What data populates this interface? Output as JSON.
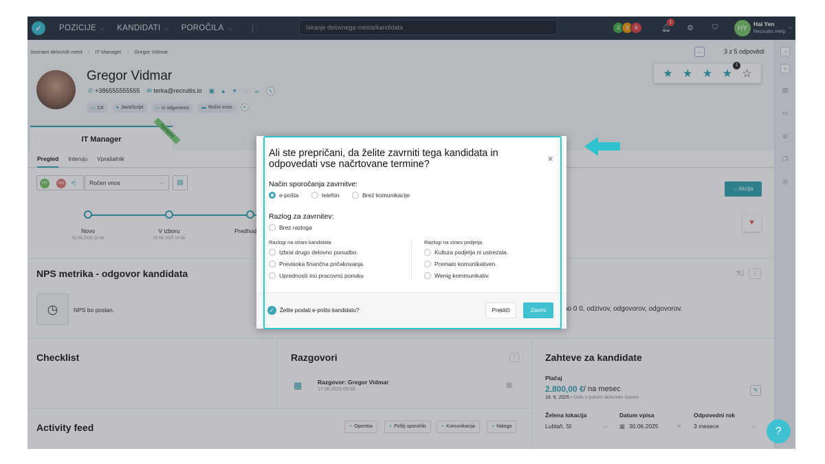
{
  "nav": {
    "items": [
      "POZICIJE",
      "KANDIDATI",
      "POROČILA"
    ],
    "search_placeholder": "Iskanje delovnega mesta/kandidata",
    "status_badges": [
      {
        "value": "0",
        "color": "#4caf50"
      },
      {
        "value": "0",
        "color": "#f39c12"
      },
      {
        "value": "6",
        "color": "#e04848"
      }
    ],
    "notification_count": "1",
    "user": {
      "initials": "HY",
      "name": "Hai Yen",
      "org": "Recruitis Help"
    }
  },
  "breadcrumb": [
    "Seznam delovnih mest",
    "IT Manager",
    "Gregor Vidmar"
  ],
  "pager": "3 z 5 odpovědí",
  "candidate": {
    "name": "Gregor Vidmar",
    "phone": "+386555555555",
    "email": "terka@recruitis.io",
    "tags": [
      "C#",
      "JavaScript",
      "Iz odgovorov",
      "Ročni vnos"
    ],
    "rating": 4,
    "rating_count": "1"
  },
  "job": {
    "title": "IT Manager",
    "ribbon": "Sprejeto"
  },
  "tabs": [
    "Pregled",
    "Intervju",
    "Vprašalnik"
  ],
  "pipeline": {
    "avatars": [
      {
        "initials": "HY",
        "color": "#7cc66f"
      },
      {
        "initials": "AN",
        "color": "#e07a7a"
      }
    ],
    "source": "Ročen vnos",
    "action": "Akcija",
    "steps": [
      {
        "label": "Novo",
        "date": "05.06.2025 10:48"
      },
      {
        "label": "V izboru",
        "date": "05.06.2025 10:56"
      },
      {
        "label": "Predhodni p",
        "date": ""
      }
    ]
  },
  "nps": {
    "title": "NPS metrika - odgovor kandidata",
    "status": "NPS bo poslan.",
    "right_text": "no 0 0, odzivov, odgovorov, odgovorov."
  },
  "checklist": {
    "title": "Checklist"
  },
  "razgovori": {
    "title": "Razgovori",
    "item_name": "Razgovor: Gregor Vidmar",
    "item_date": "17.06.2025 09:00"
  },
  "zahteve": {
    "title": "Zahteve za kandidate",
    "salary_label": "Plačaj",
    "salary_amount": "2.800,00 €",
    "salary_period": "/ na mesec",
    "salary_date": "16. 6. 2025",
    "salary_note": "Delo s polnim delovnim časom",
    "location_label": "Želena lokacija",
    "location_value": "Lublaň, SI",
    "start_label": "Datum vpisa",
    "start_value": "30.06.2025",
    "notice_label": "Odpovedni rok",
    "notice_value": "3 mesece"
  },
  "activity": {
    "title": "Activity feed",
    "buttons": [
      "Opomba",
      "Pošlji sporočilo",
      "Komunikacija",
      "Naloga"
    ]
  },
  "modal": {
    "title": "Ali ste prepričani, da želite zavrniti tega kandidata in odpovedati vse načrtovane termine?",
    "comm_label": "Način sporočanja zavrnitve:",
    "comm_options": [
      "e-pošta",
      "telefon",
      "Brez komunikacije"
    ],
    "comm_selected": 0,
    "reason_label": "Razlog za zavrnitev:",
    "no_reason": "Brez razloga",
    "cand_side_label": "Razlogi na strani kandidata",
    "cand_reasons": [
      "Izbral drugo delovno ponudbo.",
      "Previsoka finančna pričakovanja.",
      "Upredností inú pracovnú ponuku"
    ],
    "emp_side_label": "Razlogi na strani podjetja",
    "emp_reasons": [
      "Kultura podjetja ni ustrezala.",
      "Premalo komunikativen.",
      "Wenig kommunikativ."
    ],
    "send_email_label": "Želite poslati e-pošto kandidatu?",
    "cancel": "Prekliči",
    "confirm": "Zavrni"
  },
  "colors": {
    "accent": "#3aa7b5",
    "nav": "#2f3a46",
    "highlight": "#2ec2cf"
  }
}
